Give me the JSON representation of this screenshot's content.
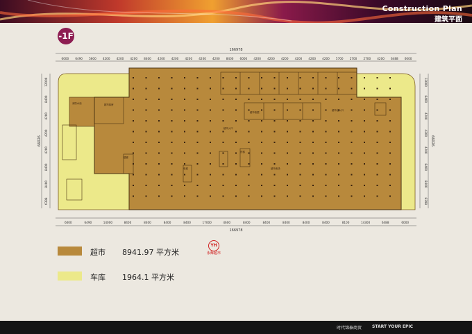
{
  "header": {
    "title_en": "Construction Plan",
    "title_cn": "建筑平面"
  },
  "floor": {
    "label": "-1F"
  },
  "plan": {
    "total_width_label": "166978",
    "depth_label": "66026",
    "top_dims": [
      "6000",
      "6490",
      "5600",
      "4200",
      "4200",
      "4200",
      "8400",
      "4200",
      "4200",
      "4200",
      "4200",
      "4200",
      "8400",
      "6000",
      "4200",
      "4200",
      "4200",
      "4200",
      "4200",
      "4200",
      "5700",
      "2700",
      "2700",
      "4200",
      "6488",
      "6000"
    ],
    "bottom_dims": [
      "6000",
      "6490",
      "14000",
      "8400",
      "8400",
      "8400",
      "8400",
      "17000",
      "4600",
      "8400",
      "8400",
      "8400",
      "8400",
      "8400",
      "8100",
      "14300",
      "6488",
      "6000"
    ],
    "left_dims": [
      "12000",
      "8400",
      "4200",
      "4200",
      "4200",
      "8400",
      "8400",
      "6398"
    ],
    "right_dims": [
      "12000",
      "8400",
      "4200",
      "4200",
      "4200",
      "8400",
      "8400",
      "8398"
    ],
    "room_labels": [
      "消防水池",
      "超市库房",
      "超市收银",
      "超市入口",
      "超市卖场",
      "楼梯",
      "电梯",
      "货梯",
      "超市出入口"
    ],
    "colors": {
      "supermarket": "#b8893c",
      "garage": "#ece98a",
      "outline": "#7a5a22",
      "wall": "#4a3212"
    }
  },
  "legend": [
    {
      "name": "超市",
      "value": "8941.97 平方米",
      "color": "#b8893c"
    },
    {
      "name": "车库",
      "value": "1964.1 平方米",
      "color": "#ece98a"
    }
  ],
  "logo": {
    "mark": "YH",
    "brand": "永辉超市"
  },
  "footer": {
    "left": "时代锦泰商贸",
    "right": "START YOUR EPIC"
  }
}
